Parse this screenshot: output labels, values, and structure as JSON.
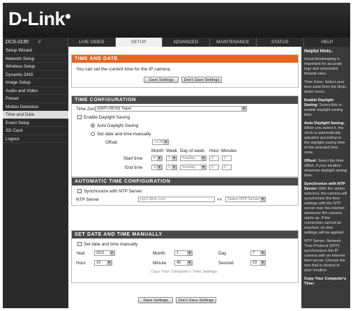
{
  "brand": {
    "logo_part1": "D-Lin",
    "logo_part2": "k"
  },
  "nav": {
    "model": "DCS-2130",
    "tabs": [
      "LIVE VIDEO",
      "SETUP",
      "ADVANCED",
      "MAINTENANCE",
      "STATUS",
      "HELP"
    ]
  },
  "sidebar": {
    "items": [
      "Setup Wizard",
      "Network Setup",
      "Wireless Setup",
      "Dynamic DNS",
      "Image Setup",
      "Audio and Video",
      "Preset",
      "Motion Detection",
      "Time and Date",
      "Event Setup",
      "SD Card",
      "Logout"
    ]
  },
  "time_and_date": {
    "title": "TIME AND DATE",
    "description": "You can set the current time for the IP camera.",
    "save": "Save Settings",
    "dont_save": "Don't Save Settings"
  },
  "time_config": {
    "title": "TIME CONFIGURATION",
    "tz_label": "Time Zone",
    "tz_value": "(GMT+08:00) Taipei",
    "dst_label": "Enable Daylight Saving",
    "auto_dst": "Auto Daylight Saving",
    "manual_dst": "Set date and time manually",
    "offset_label": "Offset",
    "offset_value": "+1:00",
    "col_month": "Month",
    "col_week": "Week",
    "col_dow": "Day of week",
    "col_hour": "Hour",
    "col_minutes": "Minutes",
    "start_label": "Start time",
    "end_label": "End time",
    "start": {
      "month": "5",
      "week": "1",
      "dow": "Sunday",
      "hour": "0",
      "min": "0"
    },
    "end": {
      "month": "10",
      "week": "1",
      "dow": "Sunday",
      "hour": "0",
      "min": "0"
    }
  },
  "auto_time": {
    "title": "AUTOMATIC TIME CONFIGURATION",
    "sync_label": "Synchronize with NTP Server",
    "ntp_label": "NTP Server",
    "ntp_value": "ntp1.dlink.com",
    "arrows": "<<",
    "ntp_select": "Select NTP Server"
  },
  "manual": {
    "title": "SET DATE AND TIME MANUALLY",
    "check_label": "Set date and time manually",
    "year_label": "Year",
    "year": "2011",
    "month_label": "Month",
    "month": "1",
    "day_label": "Day",
    "day": "7",
    "hour_label": "Hour",
    "hour": "16",
    "minute_label": "Minute",
    "minute": "40",
    "second_label": "Second",
    "second": "19",
    "copy_text": "Copy Your Computer's Time Settings"
  },
  "bottom": {
    "save": "Save Settings",
    "dont_save": "Don't Save Settings"
  },
  "help": {
    "title": "Helpful Hints..",
    "p1": "Good timekeeping is important for accurate logs and scheduled firewall rules.",
    "p2": "Time Zone: Select your time zone from the drop-down menu.",
    "p3_b": "Enable Daylight Saving:",
    "p3": "Select this to enable daylight saving time.",
    "p4_b": "Auto Daylight Saving:",
    "p4": "When you select it, the clock is automatically adjusted according to the daylight saving time of the selected time zone.",
    "p5_b": "Offset:",
    "p5": "Select the time offset, if your location observes daylight saving time.",
    "p6_b": "Synchronize with NTP Server:",
    "p6": "With the option selected, the camera will synchronize the time settings with the NTP server over the Internet whenever the camera starts up. If the connection cannot be reached, no time settings will be applied.",
    "p7": "NTP Server: Network Time Protocol (NTP) synchronizes the IP camera with an Internet time server. Choose the one that is closest to your location.",
    "p8_b": "Copy Your Computer's Time:"
  }
}
